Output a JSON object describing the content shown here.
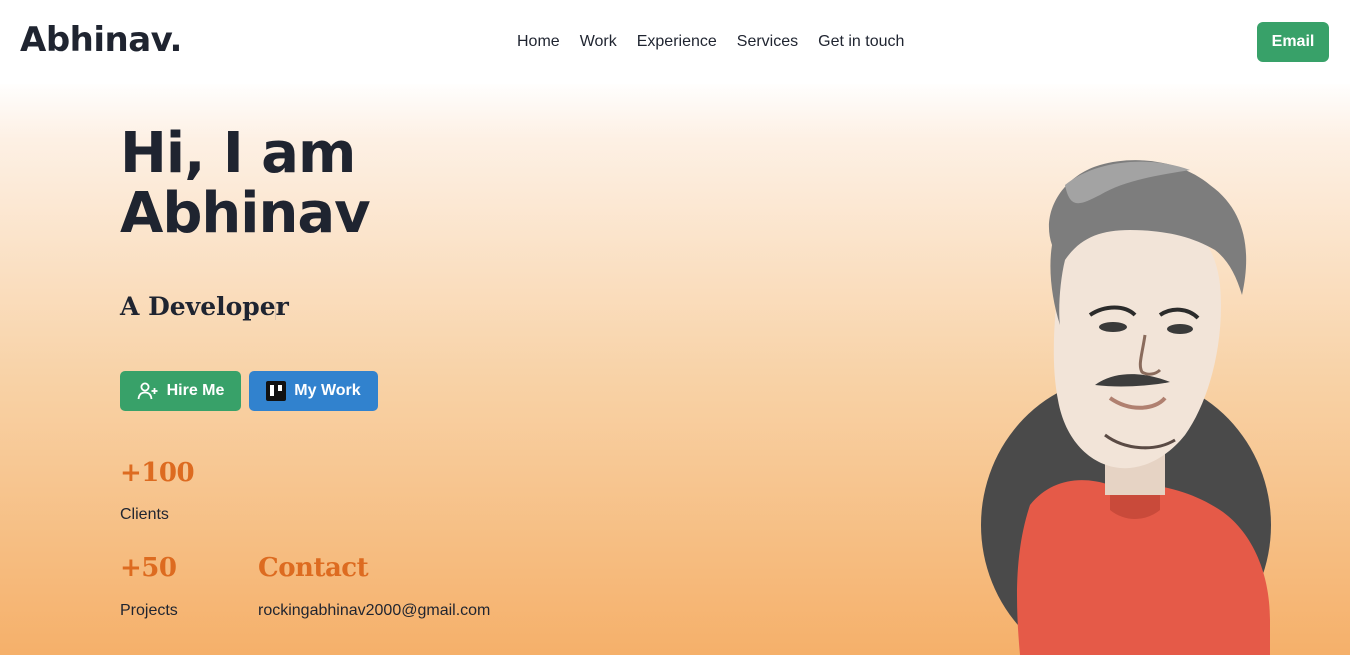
{
  "nav": {
    "logo": "Abhinav.",
    "links": [
      "Home",
      "Work",
      "Experience",
      "Services",
      "Get in touch"
    ],
    "email_button": "Email"
  },
  "hero": {
    "title_line1": "Hi, I am",
    "title_line2": "Abhinav",
    "role": "A Developer",
    "hire_button": "Hire Me",
    "work_button": "My Work"
  },
  "stats": {
    "clients_value": "+100",
    "clients_label": "Clients",
    "projects_value": "+50",
    "projects_label": "Projects",
    "contact_heading": "Contact",
    "contact_email": "rockingabhinav2000@gmail.com"
  },
  "colors": {
    "green": "#38a169",
    "blue": "#3182ce",
    "orange": "#dd6b20",
    "text": "#1f2430"
  },
  "icons": {
    "hire": "user-plus-icon",
    "work": "trello-icon"
  }
}
